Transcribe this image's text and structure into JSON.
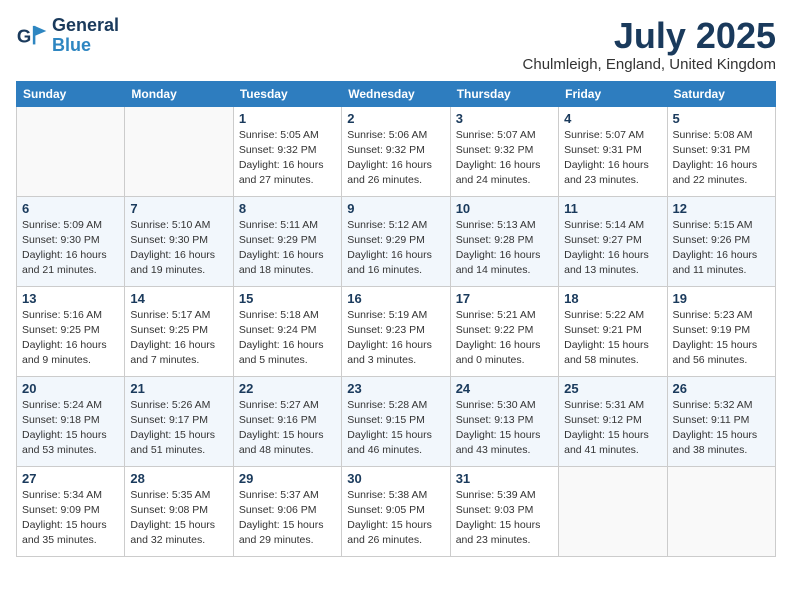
{
  "header": {
    "logo_line1": "General",
    "logo_line2": "Blue",
    "month": "July 2025",
    "location": "Chulmleigh, England, United Kingdom"
  },
  "columns": [
    "Sunday",
    "Monday",
    "Tuesday",
    "Wednesday",
    "Thursday",
    "Friday",
    "Saturday"
  ],
  "weeks": [
    [
      {
        "day": "",
        "info": ""
      },
      {
        "day": "",
        "info": ""
      },
      {
        "day": "1",
        "info": "Sunrise: 5:05 AM\nSunset: 9:32 PM\nDaylight: 16 hours and 27 minutes."
      },
      {
        "day": "2",
        "info": "Sunrise: 5:06 AM\nSunset: 9:32 PM\nDaylight: 16 hours and 26 minutes."
      },
      {
        "day": "3",
        "info": "Sunrise: 5:07 AM\nSunset: 9:32 PM\nDaylight: 16 hours and 24 minutes."
      },
      {
        "day": "4",
        "info": "Sunrise: 5:07 AM\nSunset: 9:31 PM\nDaylight: 16 hours and 23 minutes."
      },
      {
        "day": "5",
        "info": "Sunrise: 5:08 AM\nSunset: 9:31 PM\nDaylight: 16 hours and 22 minutes."
      }
    ],
    [
      {
        "day": "6",
        "info": "Sunrise: 5:09 AM\nSunset: 9:30 PM\nDaylight: 16 hours and 21 minutes."
      },
      {
        "day": "7",
        "info": "Sunrise: 5:10 AM\nSunset: 9:30 PM\nDaylight: 16 hours and 19 minutes."
      },
      {
        "day": "8",
        "info": "Sunrise: 5:11 AM\nSunset: 9:29 PM\nDaylight: 16 hours and 18 minutes."
      },
      {
        "day": "9",
        "info": "Sunrise: 5:12 AM\nSunset: 9:29 PM\nDaylight: 16 hours and 16 minutes."
      },
      {
        "day": "10",
        "info": "Sunrise: 5:13 AM\nSunset: 9:28 PM\nDaylight: 16 hours and 14 minutes."
      },
      {
        "day": "11",
        "info": "Sunrise: 5:14 AM\nSunset: 9:27 PM\nDaylight: 16 hours and 13 minutes."
      },
      {
        "day": "12",
        "info": "Sunrise: 5:15 AM\nSunset: 9:26 PM\nDaylight: 16 hours and 11 minutes."
      }
    ],
    [
      {
        "day": "13",
        "info": "Sunrise: 5:16 AM\nSunset: 9:25 PM\nDaylight: 16 hours and 9 minutes."
      },
      {
        "day": "14",
        "info": "Sunrise: 5:17 AM\nSunset: 9:25 PM\nDaylight: 16 hours and 7 minutes."
      },
      {
        "day": "15",
        "info": "Sunrise: 5:18 AM\nSunset: 9:24 PM\nDaylight: 16 hours and 5 minutes."
      },
      {
        "day": "16",
        "info": "Sunrise: 5:19 AM\nSunset: 9:23 PM\nDaylight: 16 hours and 3 minutes."
      },
      {
        "day": "17",
        "info": "Sunrise: 5:21 AM\nSunset: 9:22 PM\nDaylight: 16 hours and 0 minutes."
      },
      {
        "day": "18",
        "info": "Sunrise: 5:22 AM\nSunset: 9:21 PM\nDaylight: 15 hours and 58 minutes."
      },
      {
        "day": "19",
        "info": "Sunrise: 5:23 AM\nSunset: 9:19 PM\nDaylight: 15 hours and 56 minutes."
      }
    ],
    [
      {
        "day": "20",
        "info": "Sunrise: 5:24 AM\nSunset: 9:18 PM\nDaylight: 15 hours and 53 minutes."
      },
      {
        "day": "21",
        "info": "Sunrise: 5:26 AM\nSunset: 9:17 PM\nDaylight: 15 hours and 51 minutes."
      },
      {
        "day": "22",
        "info": "Sunrise: 5:27 AM\nSunset: 9:16 PM\nDaylight: 15 hours and 48 minutes."
      },
      {
        "day": "23",
        "info": "Sunrise: 5:28 AM\nSunset: 9:15 PM\nDaylight: 15 hours and 46 minutes."
      },
      {
        "day": "24",
        "info": "Sunrise: 5:30 AM\nSunset: 9:13 PM\nDaylight: 15 hours and 43 minutes."
      },
      {
        "day": "25",
        "info": "Sunrise: 5:31 AM\nSunset: 9:12 PM\nDaylight: 15 hours and 41 minutes."
      },
      {
        "day": "26",
        "info": "Sunrise: 5:32 AM\nSunset: 9:11 PM\nDaylight: 15 hours and 38 minutes."
      }
    ],
    [
      {
        "day": "27",
        "info": "Sunrise: 5:34 AM\nSunset: 9:09 PM\nDaylight: 15 hours and 35 minutes."
      },
      {
        "day": "28",
        "info": "Sunrise: 5:35 AM\nSunset: 9:08 PM\nDaylight: 15 hours and 32 minutes."
      },
      {
        "day": "29",
        "info": "Sunrise: 5:37 AM\nSunset: 9:06 PM\nDaylight: 15 hours and 29 minutes."
      },
      {
        "day": "30",
        "info": "Sunrise: 5:38 AM\nSunset: 9:05 PM\nDaylight: 15 hours and 26 minutes."
      },
      {
        "day": "31",
        "info": "Sunrise: 5:39 AM\nSunset: 9:03 PM\nDaylight: 15 hours and 23 minutes."
      },
      {
        "day": "",
        "info": ""
      },
      {
        "day": "",
        "info": ""
      }
    ]
  ]
}
